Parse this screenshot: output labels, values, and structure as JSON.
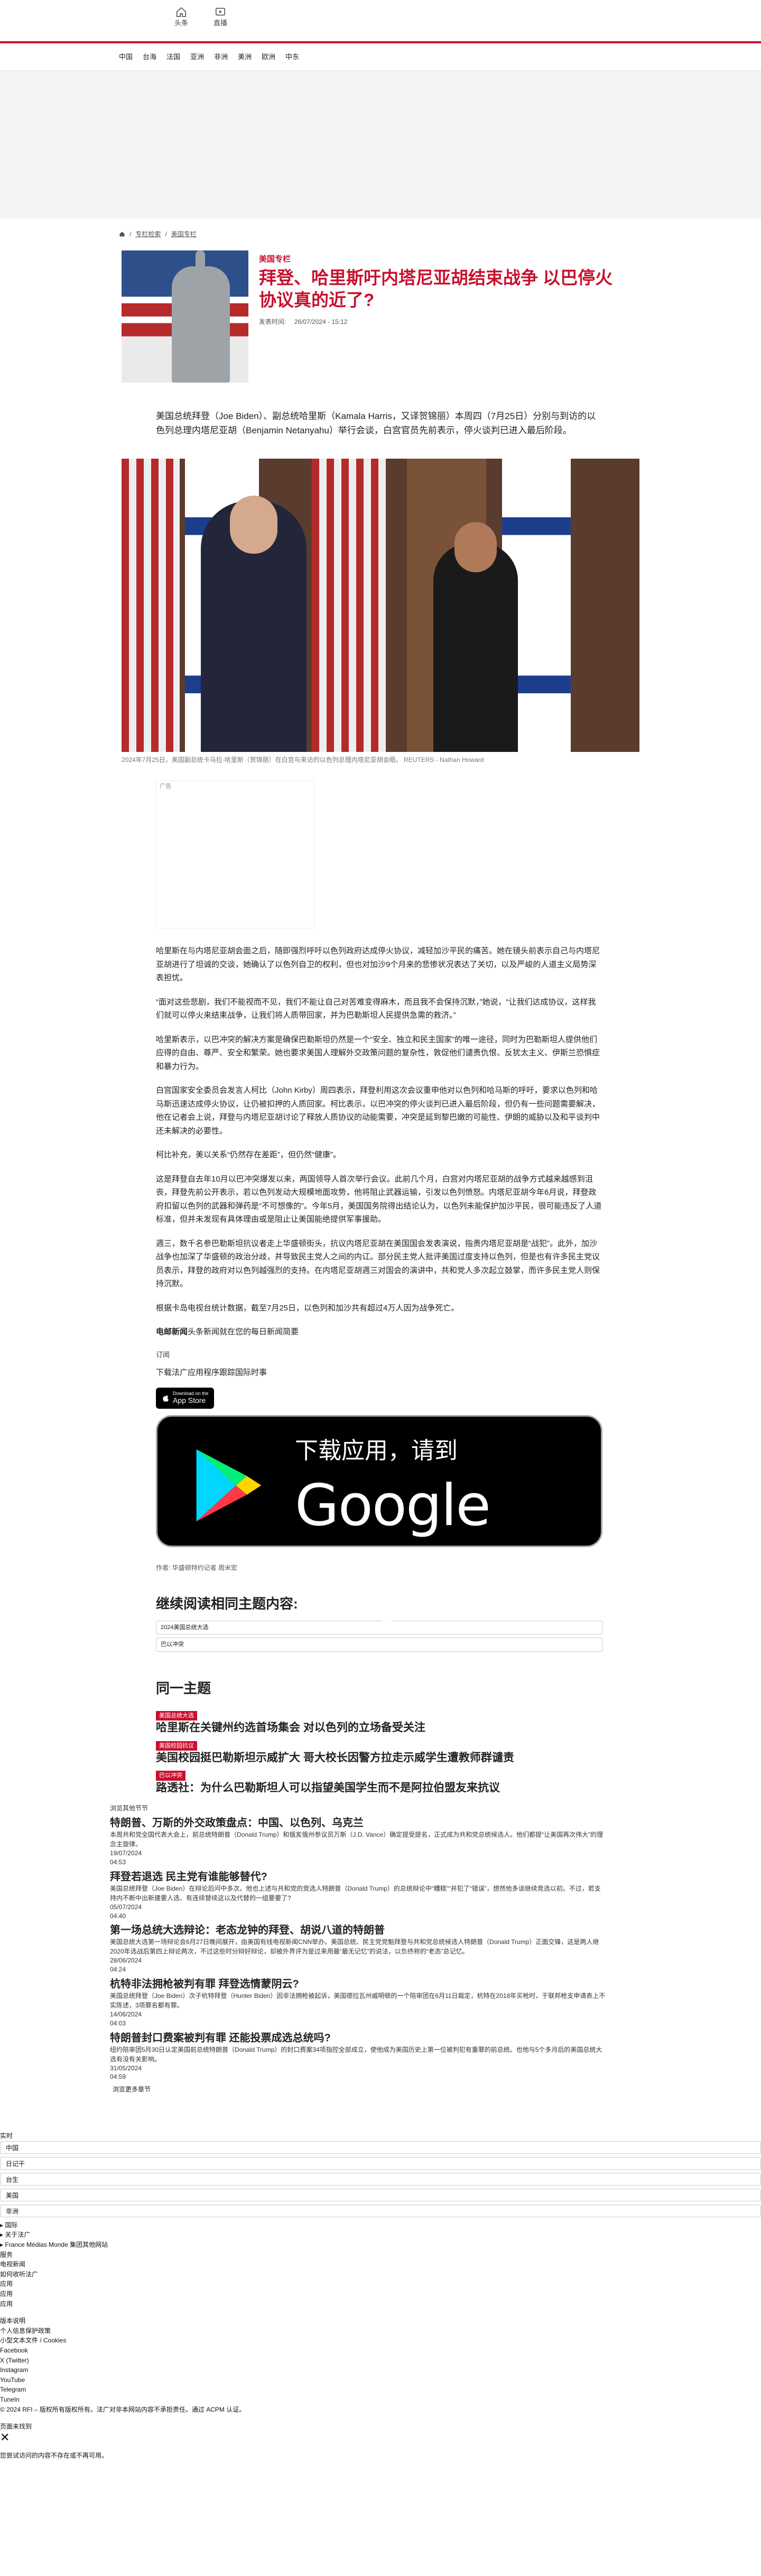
{
  "header": {
    "icons": [
      {
        "name": "home-icon",
        "label": "头条"
      },
      {
        "name": "play-icon",
        "label": "直播"
      }
    ],
    "accent_color": "#c8102e"
  },
  "nav": {
    "items": [
      "中国",
      "台海",
      "法国",
      "亚洲",
      "非洲",
      "美洲",
      "欧洲",
      "中东"
    ]
  },
  "breadcrumb": {
    "items": [
      "专栏检索",
      "美国专栏"
    ]
  },
  "article": {
    "tag": "美国专栏",
    "title": "拜登、哈里斯吁内塔尼亚胡结束战争 以巴停火协议真的近了?",
    "meta_label": "发表时间:",
    "meta_date": "26/07/2024 - 15:12",
    "lead": "美国总统拜登（Joe Biden）、副总统哈里斯（Kamala Harris，又译贺锦丽）本周四（7月25日）分别与到访的以色列总理内塔尼亚胡（Benjamin Netanyahu）举行会谈，白宫官员先前表示，停火谈判已进入最后阶段。",
    "caption": "2024年7月25日，美国副总统卡马拉·哈里斯（贺锦丽）在白宫与来访的以色列总理内塔尼亚胡会晤。   REUTERS - Nathan Howard",
    "ad_label": "广告",
    "paragraphs": [
      "哈里斯在与内塔尼亚胡会面之后，随即强烈呼吁以色列政府达成停火协议，减轻加沙平民的痛苦。她在镜头前表示自己与内塔尼亚胡进行了坦诚的交谈，她确认了以色列自卫的权利，但也对加沙9个月来的悲惨状况表达了关切，以及严峻的人道主义局势深表担忧。",
      "“面对这些悲剧，我们不能视而不见，我们不能让自己对苦难变得麻木，而且我不会保持沉默，”她说，“让我们达成协议，这样我们就可以停火来结束战争，让我们将人质带回家，并为巴勒斯坦人民提供急需的救济。”",
      "哈里斯表示，以巴冲突的解决方案是确保巴勒斯坦仍然是一个“安全、独立和民主国家”的唯一途径，同时为巴勒斯坦人提供他们应得的自由、尊严、安全和繁荣。她也要求美国人理解外交政策问题的复杂性，敦促他们谴责仇恨、反犹太主义、伊斯兰恐惧症和暴力行为。",
      "白宫国家安全委员会发言人柯比（John Kirby）周四表示，拜登利用这次会议重申他对以色列和哈马斯的呼吁，要求以色列和哈马斯迅速达成停火协议，让仍被扣押的人质回家。柯比表示，以巴冲突的停火谈判已进入最后阶段，但仍有一些问题需要解决，他在记者会上说，拜登与内塔尼亚胡讨论了释放人质协议的动能需要，冲突是延到黎巴嫩的可能性、伊朗的威胁以及和平谈判中还未解决的必要性。",
      "柯比补充，美以关系“仍然存在差距”，但仍然“健康”。",
      "这是拜登自去年10月以巴冲突爆发以来，两国领导人首次举行会议。此前几个月，白宫对内塔尼亚胡的战争方式越来越感到沮丧，拜登先前公开表示，若以色列发动大规模地面攻势，他将阻止武器运输，引发以色列愤怒。内塔尼亚胡今年6月说，拜登政府扣留以色列的武器和弹药是“不可想像的”。今年5月，美国国务院得出结论认为，以色列未能保护加沙平民，很可能违反了人道标准，但并未发现有具体理由或是阻止让美国能绝提供军事援助。",
      "週三，数千名参巴勒斯坦抗议者走上华盛顿街头，抗议内塔尼亚胡在美国国会发表演说，指责内塔尼亚胡是“战犯”。此外，加沙战争也加深了华盛顿的政治分歧，并导致民主党人之间的内讧。部分民主党人批评美国过度支持以色列，但是也有许多民主党议员表示，拜登的政府对以色列越强烈的支持。在内塔尼亚胡週三对国会的演讲中，共和党人多次起立鼓掌，而许多民主党人则保持沉默。",
      "根据卡岛电视台统计数据，截至7月25日，以色列和加沙共有超过4万人因为战争死亡。"
    ],
    "source_bold": "电邮新闻",
    "source_rest": "头条新闻就在您的每日新闻简要",
    "subscribe": "订阅",
    "app_label": "下载法广应用程序跟踪国际时事",
    "appstore_small": "Download on the",
    "appstore_big": "App Store",
    "gplay_top": "下载应用，请到",
    "gplay_brand": "Google Play",
    "author": "作者:  华盛顿特约记者 周米宏"
  },
  "continue": {
    "heading": "继续阅读相同主题内容:",
    "topics": [
      "2024美国总统大选",
      "巴以冲突"
    ]
  },
  "same_topic": {
    "heading": "同一主题",
    "items": [
      {
        "tag": "美国总统大选",
        "title": "哈里斯在关键州约选首场集会 对以色列的立场备受关注"
      },
      {
        "tag": "美国校园抗议",
        "title": "美国校园挺巴勒斯坦示威扩大 哥大校长因警方拉走示威学生遭教师群谴责"
      },
      {
        "tag": "巴以冲突",
        "title": "路透社：为什么巴勒斯坦人可以指望美国学生而不是阿拉伯盟友来抗议"
      }
    ]
  },
  "browse": {
    "label": "浏览其他节节",
    "items": [
      {
        "title": "特朗普、万斯的外交政策盘点：中国、以色列、乌克兰",
        "desc": "本周共和党全国代表大会上，前总统特朗普（Donald Trump）和俄亥俄州参议员万斯（J.D. Vance）确定提受提名，正式成为共和党总统候选人。他们都提“让美国再次伟大”的理念主旋律。",
        "date": "19/07/2024",
        "time": "04:53"
      },
      {
        "title": "拜登若退选 民主党有谁能够替代?",
        "desc": "美国总统拜登（Joe Biden）在辩论后问中多次。他也上述与共和党的竞选人特朗普（Donald Trump）的总统辩论中“糟糕”“并犯了“错误”，想然他多谈继续竞选以初。不过，若支持内不断中出新建要人选、有连续替续这以及代替的一组要要了?",
        "date": "05/07/2024",
        "time": "04:40"
      },
      {
        "title": "第一场总统大选辩论：老态龙钟的拜登、胡说八道的特朗普",
        "desc": "美国总统大选第一场辩论会6月27日晚间展开，由美国有线电视新闻CNN举办。美国总统、民主党党魁拜登与共和党总统候选人特朗普（Donald Trump）正面交锋，这是两人继2020年选战后第四上辩论两次，不过这些时分辩好辩论，却被外界评为是过来用最“最无记忆”的说法，以负终称的“老态”总记忆。",
        "date": "28/06/2024",
        "time": "04:24"
      },
      {
        "title": "杭特非法拥枪被判有罪 拜登选情蒙阴云?",
        "desc": "美国总统拜登（Joe Biden）次子杭特拜登（Hunter Biden）因非法拥枪被起诉，美国德拉瓦州威明顿的一个陪审团在6月11日裁定，杭特在2018年买枪时，于联邦枪支申请表上不实陈述，3项罪名都有罪。",
        "date": "14/06/2024",
        "time": "04:03"
      },
      {
        "title": "特朗普封口费案被判有罪 还能投票成选总统吗?",
        "desc": "纽约陪审团5月30日认定美国前总统特朗普（Donald Trump）的封口费案34项指控全部成立，使他成为美国历史上第一位被判犯有重罪的前总统。也他与5个多月后的美国总统大选有没有关影响。",
        "date": "31/05/2024",
        "time": "04:59"
      }
    ],
    "more": "浏览更多章节"
  },
  "footer": {
    "live_label": "实时",
    "selects": [
      "中国",
      "日记干",
      "台生",
      "美国",
      "非洲"
    ],
    "rows": [
      "▸ 国际",
      "▸ 关于法广",
      "▸ France Médias Monde 集团其他网站",
      "服务",
      "电视新闻",
      "如何收听法广",
      "应用",
      "应用",
      "应用",
      "",
      "版本说明",
      "个人信息保护政策",
      "小型文本文件 / Cookies",
      "Facebook",
      "X (Twitter)",
      "Instagram",
      "YouTube",
      "Telegram",
      "TuneIn",
      "© 2024 RFI – 版权所有版权所有。法广对非本网站内容不承担责任。通过 ACPM 认证。",
      "",
      "页面未找到"
    ],
    "close": "✕",
    "notfound_msg": "您尝试访问的内容不存在或不再可用。"
  }
}
